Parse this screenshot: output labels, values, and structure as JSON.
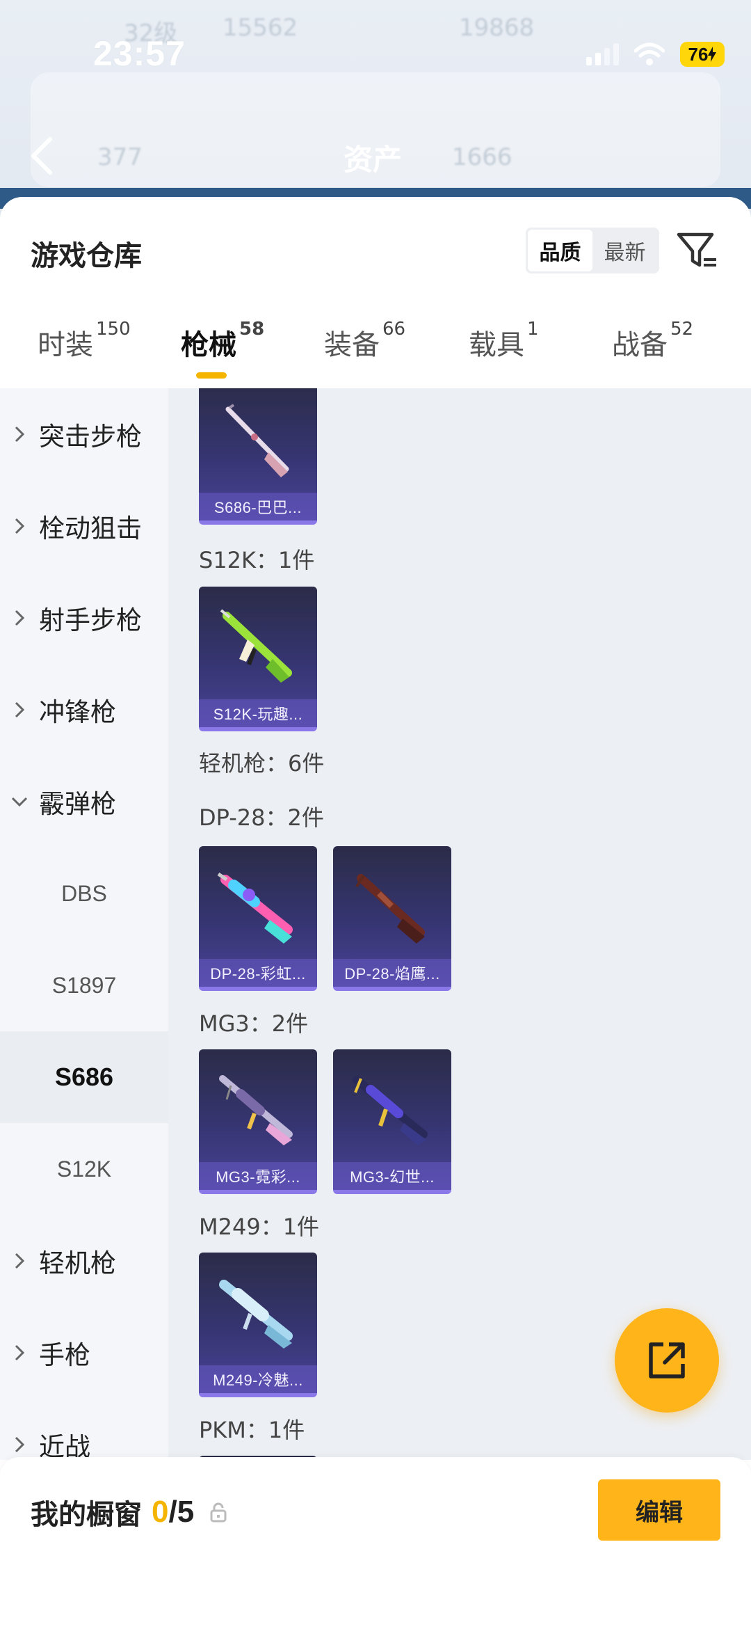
{
  "status_bar": {
    "time": "23:57",
    "battery": "76"
  },
  "header": {
    "title": "资产",
    "blurred": [
      "32级",
      "15562",
      "19868",
      "377",
      "1666"
    ]
  },
  "warehouse": {
    "title": "游戏仓库",
    "sort_options": [
      "品质",
      "最新"
    ],
    "sort_active": "品质"
  },
  "tabs": [
    {
      "label": "时装",
      "count": "150"
    },
    {
      "label": "枪械",
      "count": "58"
    },
    {
      "label": "装备",
      "count": "66"
    },
    {
      "label": "载具",
      "count": "1"
    },
    {
      "label": "战备",
      "count": "52"
    }
  ],
  "active_tab": "枪械",
  "categories": [
    {
      "label": "突击步枪",
      "expanded": false
    },
    {
      "label": "栓动狙击",
      "expanded": false
    },
    {
      "label": "射手步枪",
      "expanded": false
    },
    {
      "label": "冲锋枪",
      "expanded": false
    },
    {
      "label": "霰弹枪",
      "expanded": true
    },
    {
      "label": "DBS",
      "sub": true
    },
    {
      "label": "S1897",
      "sub": true
    },
    {
      "label": "S686",
      "sub": true,
      "selected": true
    },
    {
      "label": "S12K",
      "sub": true
    },
    {
      "label": "轻机枪",
      "expanded": false
    },
    {
      "label": "手枪",
      "expanded": false
    },
    {
      "label": "近战",
      "expanded": false
    }
  ],
  "content": {
    "groups": [
      {
        "label": "S12K：1件"
      },
      {
        "label": "轻机枪：6件"
      },
      {
        "label": "DP-28：2件"
      },
      {
        "label": "MG3：2件"
      },
      {
        "label": "M249：1件"
      },
      {
        "label": "PKM：1件"
      }
    ],
    "items": [
      {
        "name": "S686-巴巴..."
      },
      {
        "name": "S12K-玩趣..."
      },
      {
        "name": "DP-28-彩虹..."
      },
      {
        "name": "DP-28-焰鹰..."
      },
      {
        "name": "MG3-霓彩..."
      },
      {
        "name": "MG3-幻世..."
      },
      {
        "name": "M249-冷魅..."
      }
    ]
  },
  "showcase": {
    "label": "我的橱窗",
    "used": "0",
    "separator": "/",
    "total": "5",
    "edit_label": "编辑"
  },
  "colors": {
    "accent": "#ffb41a",
    "card_bg": "#363572",
    "card_border": "#8a78e8"
  }
}
